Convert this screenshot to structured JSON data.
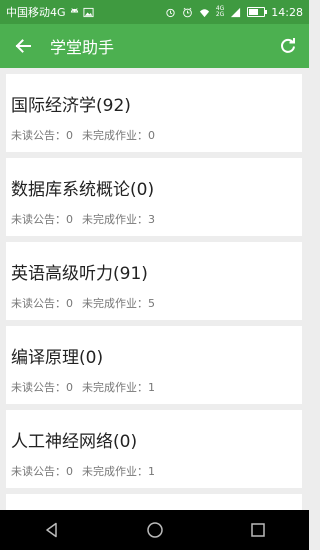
{
  "status_bar": {
    "carrier": "中国移动4G",
    "network_small": [
      "4G",
      "2G"
    ],
    "time": "14:28",
    "battery_level": 0.6,
    "icons": [
      "android-icon",
      "image-icon",
      "alarm-icon",
      "clock-icon",
      "wifi-icon",
      "signal-icon",
      "battery-icon"
    ]
  },
  "app_bar": {
    "title": "学堂助手",
    "back_icon": "back-arrow-icon",
    "refresh_icon": "refresh-icon",
    "background": "#4cb050",
    "status_background": "#3f9a40"
  },
  "courses": [
    {
      "name": "国际经济学(92)",
      "unread_label": "未读公告：0",
      "homework_label": "未完成作业：0"
    },
    {
      "name": "数据库系统概论(0)",
      "unread_label": "未读公告：0",
      "homework_label": "未完成作业：3"
    },
    {
      "name": "英语高级听力(91)",
      "unread_label": "未读公告：0",
      "homework_label": "未完成作业：5"
    },
    {
      "name": "编译原理(0)",
      "unread_label": "未读公告：0",
      "homework_label": "未完成作业：1"
    },
    {
      "name": "人工神经网络(0)",
      "unread_label": "未读公告：0",
      "homework_label": "未完成作业：1"
    }
  ],
  "nav_bar": {
    "icons": [
      "back-triangle-icon",
      "home-circle-icon",
      "recents-square-icon"
    ]
  }
}
